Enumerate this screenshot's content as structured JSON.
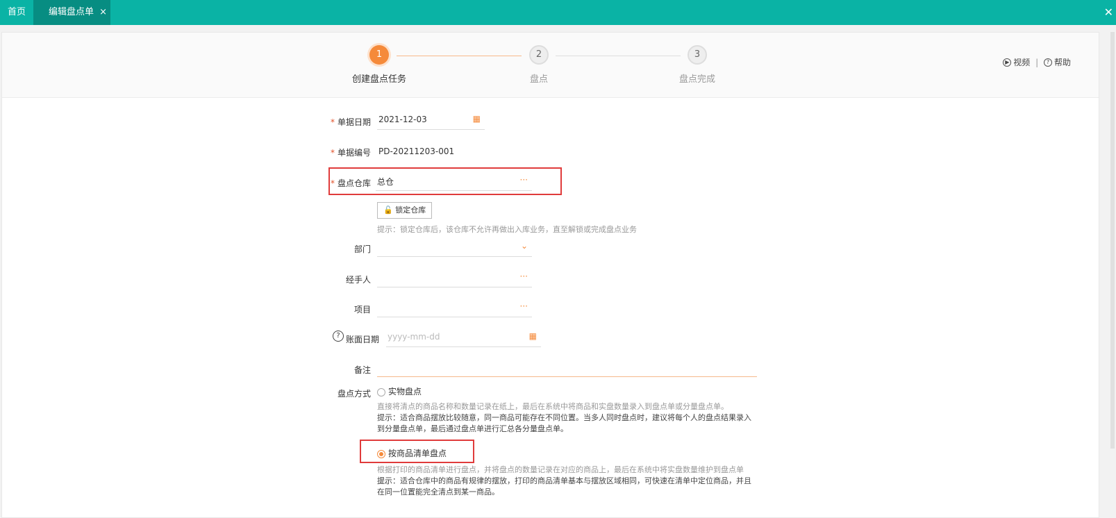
{
  "tabs": [
    {
      "label": "首页"
    },
    {
      "label": "编辑盘点单",
      "close": "×"
    }
  ],
  "window_close": "✕",
  "steps": [
    {
      "num": "1",
      "label": "创建盘点任务"
    },
    {
      "num": "2",
      "label": "盘点"
    },
    {
      "num": "3",
      "label": "盘点完成"
    }
  ],
  "top_links": {
    "video": "视频",
    "help": "帮助",
    "separator": "|"
  },
  "form": {
    "doc_date": {
      "label": "单据日期",
      "value": "2021-12-03"
    },
    "doc_no": {
      "label": "单据编号",
      "value": "PD-20211203-001"
    },
    "warehouse": {
      "label": "盘点仓库",
      "value": "总仓",
      "more": "···"
    },
    "lock_button": "锁定仓库",
    "lock_hint": "提示：锁定仓库后，该仓库不允许再做出入库业务，直至解锁或完成盘点业务",
    "department": {
      "label": "部门",
      "value": ""
    },
    "handler": {
      "label": "经手人",
      "value": "",
      "more": "···"
    },
    "project": {
      "label": "项目",
      "value": "",
      "more": "···"
    },
    "book_date": {
      "label": "账面日期",
      "placeholder": "yyyy-mm-dd"
    },
    "remark": {
      "label": "备注",
      "value": ""
    },
    "method_label": "盘点方式",
    "required_mark": "*",
    "method_options": [
      {
        "label": "实物盘点",
        "checked": false,
        "desc": "直接将清点的商品名称和数量记录在纸上，最后在系统中将商品和实盘数量录入到盘点单或分量盘点单。",
        "tip": "提示：适合商品摆放比较随意，同一商品可能存在不同位置。当多人同时盘点时，建议将每个人的盘点结果录入到分量盘点单，最后通过盘点单进行汇总各分量盘点单。"
      },
      {
        "label": "按商品清单盘点",
        "checked": true,
        "desc": "根据打印的商品清单进行盘点，并将盘点的数量记录在对应的商品上，最后在系统中将实盘数量维护到盘点单上。",
        "tip": "提示：适合仓库中的商品有规律的摆放，打印的商品清单基本与摆放区域相同，可快速在清单中定位商品，并且在同一位置能完全清点到某一商品。"
      }
    ]
  },
  "colors": {
    "accent": "#f58a3a",
    "topbar": "#0ab3a5",
    "highlight": "#e03b3b"
  }
}
